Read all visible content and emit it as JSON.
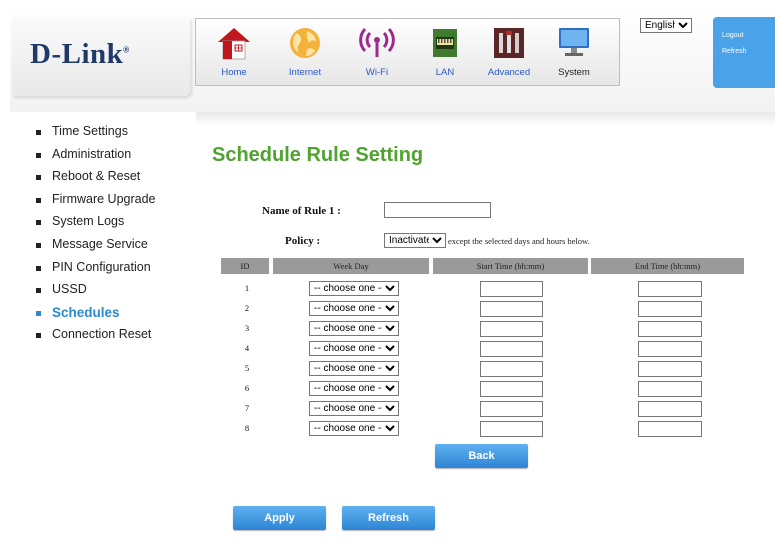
{
  "header": {
    "brand": "D-Link",
    "brand_mark": "®",
    "nav": [
      {
        "label": "Home",
        "icon": "home-icon"
      },
      {
        "label": "Internet",
        "icon": "globe-icon"
      },
      {
        "label": "Wi-Fi",
        "icon": "wifi-icon"
      },
      {
        "label": "LAN",
        "icon": "lan-icon"
      },
      {
        "label": "Advanced",
        "icon": "tools-icon"
      },
      {
        "label": "System",
        "icon": "computer-icon"
      }
    ],
    "language": "English",
    "logout_label": "Logout",
    "refresh_label": "Refresh"
  },
  "sidebar": {
    "items": [
      {
        "label": "Time Settings"
      },
      {
        "label": "Administration"
      },
      {
        "label": "Reboot & Reset"
      },
      {
        "label": "Firmware Upgrade"
      },
      {
        "label": "System Logs"
      },
      {
        "label": "Message Service"
      },
      {
        "label": "PIN Configuration"
      },
      {
        "label": "USSD"
      },
      {
        "label": "Schedules",
        "active": true
      },
      {
        "label": "Connection Reset"
      }
    ]
  },
  "main": {
    "title": "Schedule Rule Setting",
    "rule_name_label": "Name of Rule 1 :",
    "rule_name_value": "",
    "policy_label": "Policy :",
    "policy_value": "Inactivate",
    "policy_note": "except the selected days and hours below.",
    "table": {
      "headers": [
        "ID",
        "Week Day",
        "Start Time (hh:mm)",
        "End Time (hh:mm)"
      ],
      "rows": [
        {
          "id": "1",
          "weekday": "-- choose one --",
          "start": "",
          "end": ""
        },
        {
          "id": "2",
          "weekday": "-- choose one --",
          "start": "",
          "end": ""
        },
        {
          "id": "3",
          "weekday": "-- choose one --",
          "start": "",
          "end": ""
        },
        {
          "id": "4",
          "weekday": "-- choose one --",
          "start": "",
          "end": ""
        },
        {
          "id": "5",
          "weekday": "-- choose one --",
          "start": "",
          "end": ""
        },
        {
          "id": "6",
          "weekday": "-- choose one --",
          "start": "",
          "end": ""
        },
        {
          "id": "7",
          "weekday": "-- choose one --",
          "start": "",
          "end": ""
        },
        {
          "id": "8",
          "weekday": "-- choose one --",
          "start": "",
          "end": ""
        }
      ]
    },
    "back_label": "Back",
    "apply_label": "Apply",
    "refresh_label": "Refresh"
  },
  "colors": {
    "title_green": "#4fa32f",
    "active_blue": "#2a8ad4",
    "button_blue": "#3a95de",
    "header_gray": "#9a9a9a",
    "brand_navy": "#1f3a6a"
  }
}
